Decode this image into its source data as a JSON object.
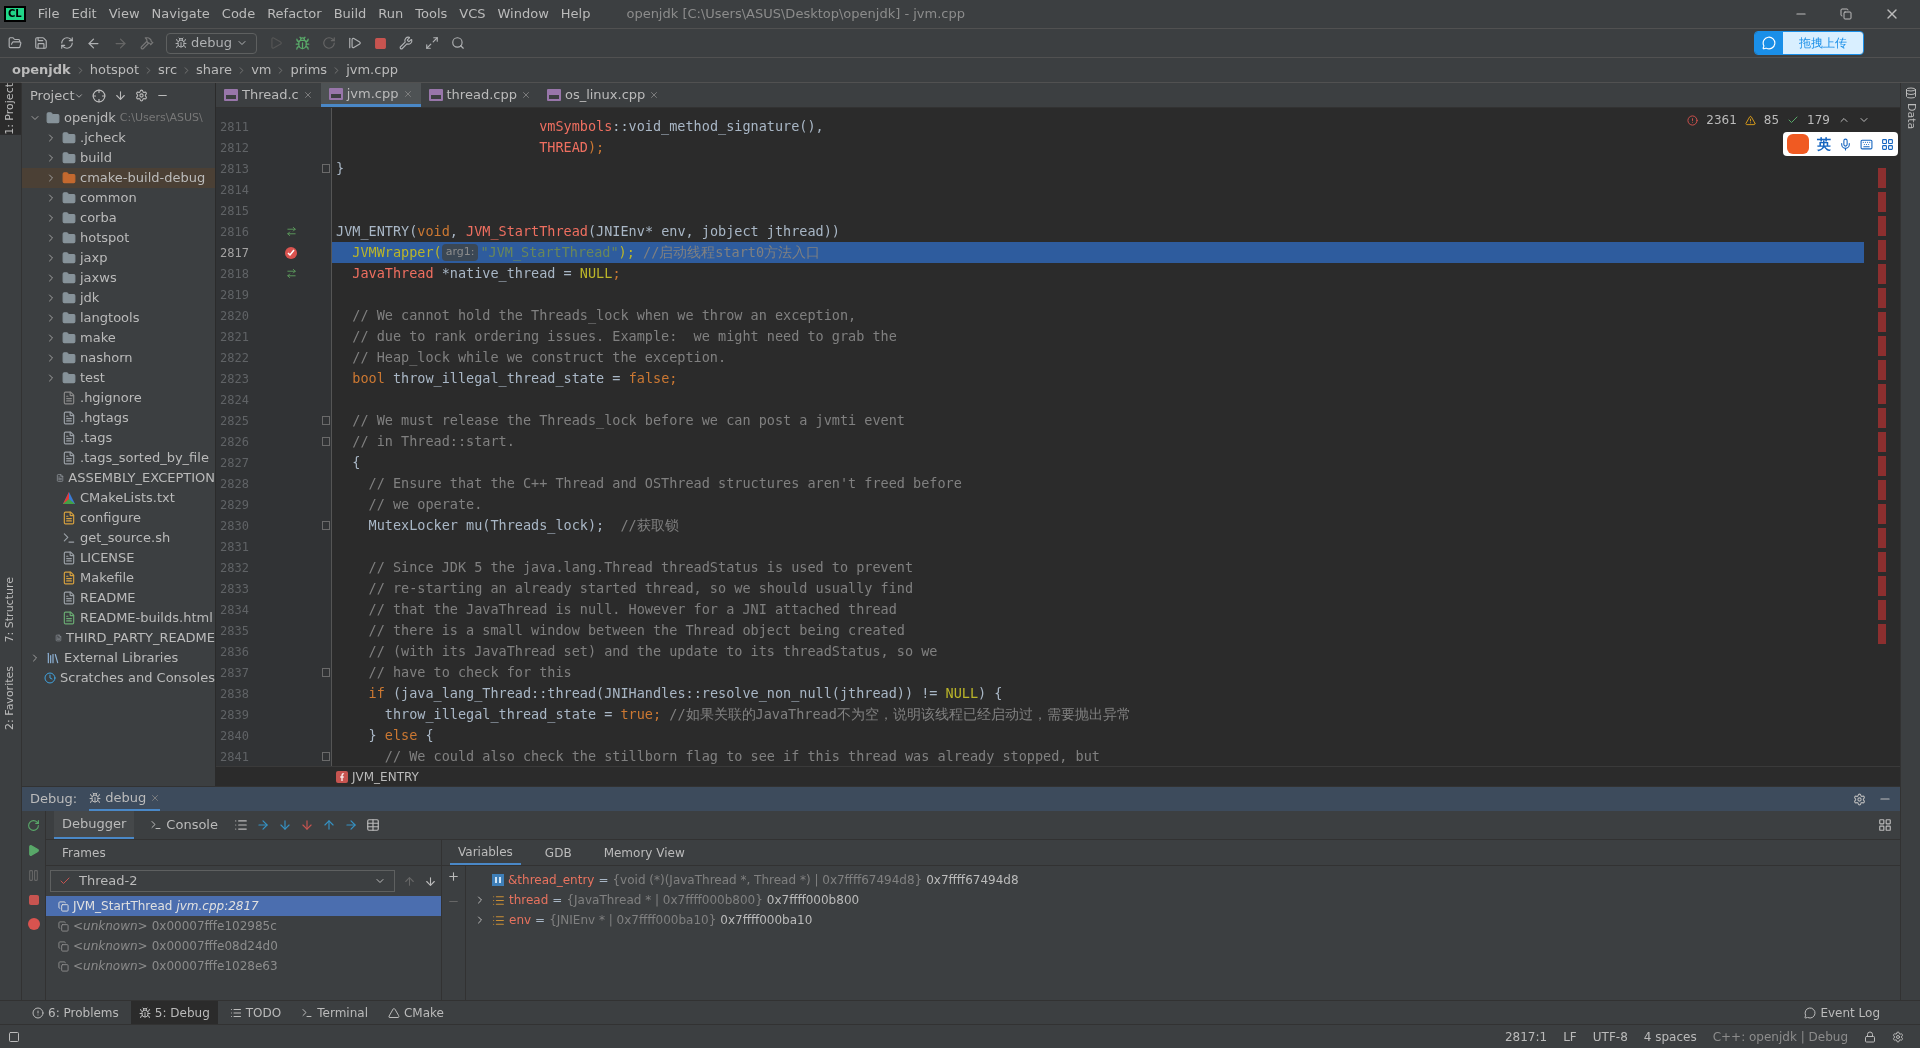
{
  "window": {
    "logo": "CL",
    "title": "openjdk [C:\\Users\\ASUS\\Desktop\\openjdk] - jvm.cpp",
    "menu": [
      "File",
      "Edit",
      "View",
      "Navigate",
      "Code",
      "Refactor",
      "Build",
      "Run",
      "Tools",
      "VCS",
      "Window",
      "Help"
    ]
  },
  "toolbar": {
    "config": "debug"
  },
  "upload_widget": {
    "label": "拖拽上传"
  },
  "breadcrumb": [
    "openjdk",
    "hotspot",
    "src",
    "share",
    "vm",
    "prims",
    "jvm.cpp"
  ],
  "left_strip": [
    "1: Project",
    "7: Structure",
    "2: Favorites"
  ],
  "right_strip": [
    "Data"
  ],
  "project": {
    "title": "Project",
    "tree": [
      {
        "name": "openjdk",
        "note": "C:\\Users\\ASUS\\",
        "kind": "folder",
        "expanded": true,
        "selected": false,
        "children": [
          {
            "name": ".jcheck",
            "kind": "folder",
            "expanded": false,
            "selected": false
          },
          {
            "name": "build",
            "kind": "folder",
            "expanded": false,
            "selected": false
          },
          {
            "name": "cmake-build-debug",
            "kind": "folder",
            "expanded": false,
            "selected": true
          },
          {
            "name": "common",
            "kind": "folder",
            "expanded": false,
            "selected": false
          },
          {
            "name": "corba",
            "kind": "folder",
            "expanded": false,
            "selected": false
          },
          {
            "name": "hotspot",
            "kind": "folder",
            "expanded": false,
            "selected": false
          },
          {
            "name": "jaxp",
            "kind": "folder",
            "expanded": false,
            "selected": false
          },
          {
            "name": "jaxws",
            "kind": "folder",
            "expanded": false,
            "selected": false
          },
          {
            "name": "jdk",
            "kind": "folder",
            "expanded": false,
            "selected": false
          },
          {
            "name": "langtools",
            "kind": "folder",
            "expanded": false,
            "selected": false
          },
          {
            "name": "make",
            "kind": "folder",
            "expanded": false,
            "selected": false
          },
          {
            "name": "nashorn",
            "kind": "folder",
            "expanded": false,
            "selected": false
          },
          {
            "name": "test",
            "kind": "folder",
            "expanded": false,
            "selected": false
          },
          {
            "name": ".hgignore",
            "kind": "ignored",
            "selected": false
          },
          {
            "name": ".hgtags",
            "kind": "text",
            "selected": false
          },
          {
            "name": ".tags",
            "kind": "text",
            "selected": false
          },
          {
            "name": ".tags_sorted_by_file",
            "kind": "text",
            "selected": false
          },
          {
            "name": "ASSEMBLY_EXCEPTION",
            "kind": "text",
            "selected": false
          },
          {
            "name": "CMakeLists.txt",
            "kind": "cmake",
            "selected": false
          },
          {
            "name": "configure",
            "kind": "build",
            "selected": false
          },
          {
            "name": "get_source.sh",
            "kind": "shell",
            "selected": false
          },
          {
            "name": "LICENSE",
            "kind": "text",
            "selected": false
          },
          {
            "name": "Makefile",
            "kind": "build",
            "selected": false
          },
          {
            "name": "README",
            "kind": "text",
            "selected": false
          },
          {
            "name": "README-builds.html",
            "kind": "html",
            "selected": false
          },
          {
            "name": "THIRD_PARTY_README",
            "kind": "text",
            "selected": false
          }
        ]
      },
      {
        "name": "External Libraries",
        "kind": "libraries",
        "expanded": false,
        "selected": false
      },
      {
        "name": "Scratches and Consoles",
        "kind": "scratches",
        "selected": false
      }
    ]
  },
  "editor": {
    "tabs": [
      {
        "label": "Thread.c",
        "selected": false
      },
      {
        "label": "jvm.cpp",
        "selected": true
      },
      {
        "label": "thread.cpp",
        "selected": false
      },
      {
        "label": "os_linux.cpp",
        "selected": false
      }
    ],
    "inspections": {
      "errors": "2361",
      "warnings": "85",
      "typos": "179"
    },
    "lines": [
      {
        "number": "2811",
        "current": false,
        "kind": "plain",
        "fold": false,
        "tokens": [
          {
            "t": "                         vmSymbols",
            "kind": "type"
          },
          {
            "t": "::void_method_signature(),",
            "kind": "plain"
          }
        ]
      },
      {
        "number": "2812",
        "current": false,
        "kind": "plain",
        "fold": false,
        "tokens": [
          {
            "t": "                         THREAD",
            "kind": "type"
          },
          {
            "t": ");",
            "kind": "keyword"
          }
        ]
      },
      {
        "number": "2813",
        "current": false,
        "kind": "plain",
        "fold": true,
        "tokens": [
          {
            "t": "}",
            "kind": "plain"
          }
        ]
      },
      {
        "number": "2814",
        "current": false,
        "kind": "plain",
        "fold": false
      },
      {
        "number": "2815",
        "current": false,
        "kind": "plain",
        "fold": false
      },
      {
        "number": "2816",
        "current": false,
        "kind": "override",
        "fold": false,
        "tokens": [
          {
            "t": "JVM_ENTRY(",
            "kind": "plain"
          },
          {
            "t": "void",
            "kind": "keyword"
          },
          {
            "t": ", ",
            "kind": "plain"
          },
          {
            "t": "JVM_StartThread",
            "kind": "type"
          },
          {
            "t": "(JNIEnv* env, jobject jthread))",
            "kind": "plain"
          }
        ]
      },
      {
        "number": "2817",
        "current": true,
        "kind": "breakpoint",
        "fold": false,
        "tokens": [
          {
            "t": "  JVMWrapper(",
            "kind": "const"
          },
          {
            "t": "arg1:",
            "kind": "hint"
          },
          {
            "t": "\"JVM_StartThread\"",
            "kind": "string"
          },
          {
            "t": "); ",
            "kind": "const"
          },
          {
            "t": "//启动线程start0方法入口",
            "kind": "comment"
          }
        ]
      },
      {
        "number": "2818",
        "current": false,
        "kind": "override",
        "fold": false,
        "tokens": [
          {
            "t": "  JavaThread",
            "kind": "type"
          },
          {
            "t": " *native_thread = ",
            "kind": "plain"
          },
          {
            "t": "NULL",
            "kind": "const"
          },
          {
            "t": ";",
            "kind": "keyword"
          }
        ]
      },
      {
        "number": "2819",
        "current": false,
        "kind": "plain",
        "fold": false
      },
      {
        "number": "2820",
        "current": false,
        "kind": "plain",
        "fold": false,
        "tokens": [
          {
            "t": "  // We cannot hold the Threads_lock when we throw an exception,",
            "kind": "comment"
          }
        ]
      },
      {
        "number": "2821",
        "current": false,
        "kind": "plain",
        "fold": false,
        "tokens": [
          {
            "t": "  // due to rank ordering issues. Example:  we might need to grab the",
            "kind": "comment"
          }
        ]
      },
      {
        "number": "2822",
        "current": false,
        "kind": "plain",
        "fold": false,
        "tokens": [
          {
            "t": "  // Heap_lock while we construct the exception.",
            "kind": "comment"
          }
        ]
      },
      {
        "number": "2823",
        "current": false,
        "kind": "plain",
        "fold": false,
        "tokens": [
          {
            "t": "  bool",
            "kind": "keyword"
          },
          {
            "t": " throw_illegal_thread_state = ",
            "kind": "plain"
          },
          {
            "t": "false;",
            "kind": "keyword"
          }
        ]
      },
      {
        "number": "2824",
        "current": false,
        "kind": "plain",
        "fold": false
      },
      {
        "number": "2825",
        "current": false,
        "kind": "plain",
        "fold": true,
        "tokens": [
          {
            "t": "  // We must release the Threads_lock before we can post a jvmti event",
            "kind": "comment"
          }
        ]
      },
      {
        "number": "2826",
        "current": false,
        "kind": "plain",
        "fold": true,
        "tokens": [
          {
            "t": "  // in Thread::start.",
            "kind": "comment"
          }
        ]
      },
      {
        "number": "2827",
        "current": false,
        "kind": "plain",
        "fold": false,
        "tokens": [
          {
            "t": "  {",
            "kind": "plain"
          }
        ]
      },
      {
        "number": "2828",
        "current": false,
        "kind": "plain",
        "fold": false,
        "tokens": [
          {
            "t": "    // Ensure that the C++ Thread and OSThread structures aren't freed before",
            "kind": "comment"
          }
        ]
      },
      {
        "number": "2829",
        "current": false,
        "kind": "plain",
        "fold": false,
        "tokens": [
          {
            "t": "    // we operate.",
            "kind": "comment"
          }
        ]
      },
      {
        "number": "2830",
        "current": false,
        "kind": "plain",
        "fold": true,
        "tokens": [
          {
            "t": "    MutexLocker mu(Threads_lock);  ",
            "kind": "plain"
          },
          {
            "t": "//获取锁",
            "kind": "comment"
          }
        ]
      },
      {
        "number": "2831",
        "current": false,
        "kind": "plain",
        "fold": false
      },
      {
        "number": "2832",
        "current": false,
        "kind": "plain",
        "fold": false,
        "tokens": [
          {
            "t": "    // Since JDK 5 the java.lang.Thread threadStatus is used to prevent",
            "kind": "comment"
          }
        ]
      },
      {
        "number": "2833",
        "current": false,
        "kind": "plain",
        "fold": false,
        "tokens": [
          {
            "t": "    // re-starting an already started thread, so we should usually find",
            "kind": "comment"
          }
        ]
      },
      {
        "number": "2834",
        "current": false,
        "kind": "plain",
        "fold": false,
        "tokens": [
          {
            "t": "    // that the JavaThread is null. However for a JNI attached thread",
            "kind": "comment"
          }
        ]
      },
      {
        "number": "2835",
        "current": false,
        "kind": "plain",
        "fold": false,
        "tokens": [
          {
            "t": "    // there is a small window between the Thread object being created",
            "kind": "comment"
          }
        ]
      },
      {
        "number": "2836",
        "current": false,
        "kind": "plain",
        "fold": false,
        "tokens": [
          {
            "t": "    // (with its JavaThread set) and the update to its threadStatus, so we",
            "kind": "comment"
          }
        ]
      },
      {
        "number": "2837",
        "current": false,
        "kind": "plain",
        "fold": true,
        "tokens": [
          {
            "t": "    // have to check for this",
            "kind": "comment"
          }
        ]
      },
      {
        "number": "2838",
        "current": false,
        "kind": "plain",
        "fold": false,
        "tokens": [
          {
            "t": "    if",
            "kind": "keyword"
          },
          {
            "t": " (java_lang_Thread::thread(JNIHandles::resolve_non_null(jthread)) != ",
            "kind": "plain"
          },
          {
            "t": "NULL",
            "kind": "const"
          },
          {
            "t": ") {",
            "kind": "plain"
          }
        ]
      },
      {
        "number": "2839",
        "current": false,
        "kind": "plain",
        "fold": false,
        "tokens": [
          {
            "t": "      throw_illegal_thread_state = ",
            "kind": "plain"
          },
          {
            "t": "true;",
            "kind": "keyword"
          },
          {
            "t": " //如果关联的JavaThread不为空，说明该线程已经启动过，需要抛出异常",
            "kind": "comment"
          }
        ]
      },
      {
        "number": "2840",
        "current": false,
        "kind": "plain",
        "fold": false,
        "tokens": [
          {
            "t": "    } ",
            "kind": "plain"
          },
          {
            "t": "else",
            "kind": "keyword"
          },
          {
            "t": " {",
            "kind": "plain"
          }
        ]
      },
      {
        "number": "2841",
        "current": false,
        "kind": "plain",
        "fold": true,
        "tokens": [
          {
            "t": "      // We could also check the stillborn flag to see if this thread was already stopped, but",
            "kind": "comment"
          }
        ]
      }
    ],
    "footer": "JVM_ENTRY"
  },
  "ime_bar": {
    "label": "英"
  },
  "debug": {
    "title": "Debug:",
    "session": "debug",
    "tabs": [
      {
        "label": "Debugger",
        "selected": true
      },
      {
        "label": "Console",
        "selected": false
      }
    ],
    "frames_title": "Frames",
    "thread": "Thread-2",
    "frames": [
      {
        "name": "JVM_StartThread",
        "location": "jvm.cpp:2817",
        "selected": true
      },
      {
        "name": "<unknown>",
        "location": "0x00007fffe102985c",
        "selected": false
      },
      {
        "name": "<unknown>",
        "location": "0x00007fffe08d24d0",
        "selected": false
      },
      {
        "name": "<unknown>",
        "location": "0x00007fffe1028e63",
        "selected": false
      }
    ],
    "var_tabs": [
      {
        "label": "Variables",
        "selected": true
      },
      {
        "label": "GDB",
        "selected": false
      },
      {
        "label": "Memory View",
        "selected": false
      }
    ],
    "variables": [
      {
        "name": "&thread_entry",
        "kind": "pointer",
        "expandable": false,
        "separator": "=",
        "type": "{void (*)(JavaThread *, Thread *) | 0x7ffff67494d8}",
        "value": "0x7ffff67494d8"
      },
      {
        "name": "thread",
        "kind": "struct",
        "expandable": true,
        "separator": "=",
        "type": "{JavaThread * | 0x7ffff000b800}",
        "value": "0x7ffff000b800"
      },
      {
        "name": "env",
        "kind": "struct",
        "expandable": true,
        "separator": "=",
        "type": "{JNIEnv * | 0x7ffff000ba10}",
        "value": "0x7ffff000ba10"
      }
    ]
  },
  "tool_tabs": [
    {
      "label": "6: Problems",
      "kind": "problems",
      "selected": false
    },
    {
      "label": "5: Debug",
      "kind": "debug",
      "selected": true
    },
    {
      "label": "TODO",
      "kind": "todo",
      "selected": false
    },
    {
      "label": "Terminal",
      "kind": "terminal",
      "selected": false
    },
    {
      "label": "CMake",
      "kind": "cmake",
      "selected": false
    }
  ],
  "event_log": "Event Log",
  "status_bar": [
    "2817:1",
    "LF",
    "UTF-8",
    "4 spaces",
    "C++: openjdk | Debug"
  ]
}
